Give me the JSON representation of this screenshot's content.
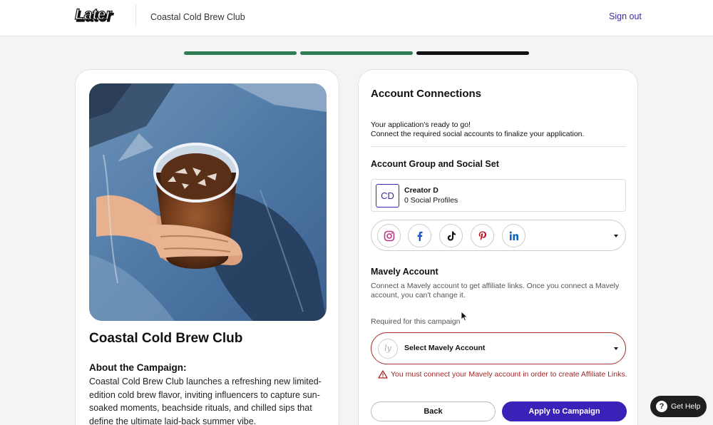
{
  "header": {
    "logo_text": "Later",
    "brand_name": "Coastal Cold Brew Club",
    "signout_label": "Sign out"
  },
  "progress": {
    "total_steps": 3,
    "completed_steps": 2,
    "current_step": 3,
    "completed_color": "#2f7d53",
    "current_color": "#111111"
  },
  "campaign": {
    "title": "Coastal Cold Brew Club",
    "about_heading": "About the Campaign:",
    "about_text": "Coastal Cold Brew Club launches a refreshing new limited-edition cold brew flavor, inviting influencers to capture sun-soaked moments, beachside rituals, and chilled sips that define the ultimate laid-back summer vibe."
  },
  "connections": {
    "title": "Account Connections",
    "ready_text": "Your application's ready to go!",
    "connect_text": "Connect the required social accounts to finalize your application.",
    "group_title": "Account Group and Social Set",
    "creator": {
      "initials": "CD",
      "name": "Creator D",
      "profiles": "0 Social Profiles"
    },
    "social_icons": [
      "instagram-icon",
      "facebook-icon",
      "tiktok-icon",
      "pinterest-icon",
      "linkedin-icon"
    ],
    "mavely": {
      "title": "Mavely Account",
      "description": "Connect a Mavely account to get affiliate links. Once you connect a Mavely account, you can't change it.",
      "required_label": "Required for this campaign",
      "logo_text": "ly",
      "select_label": "Select Mavely Account",
      "error_text": "You must connect your Mavely account in order to create Affiliate Links.",
      "error_color": "#a02828"
    },
    "back_label": "Back",
    "apply_label": "Apply to Campaign",
    "accent_color": "#3a21b8"
  },
  "help": {
    "icon_text": "?",
    "label": "Get Help"
  }
}
